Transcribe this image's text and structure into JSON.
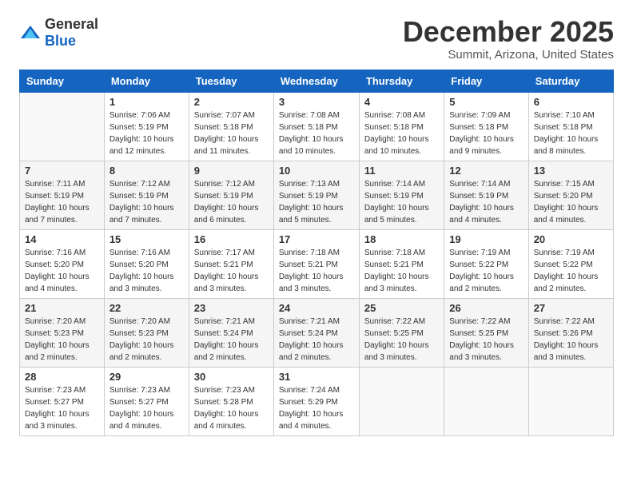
{
  "logo": {
    "general": "General",
    "blue": "Blue"
  },
  "title": "December 2025",
  "subtitle": "Summit, Arizona, United States",
  "weekdays": [
    "Sunday",
    "Monday",
    "Tuesday",
    "Wednesday",
    "Thursday",
    "Friday",
    "Saturday"
  ],
  "weeks": [
    [
      {
        "day": "",
        "info": ""
      },
      {
        "day": "1",
        "info": "Sunrise: 7:06 AM\nSunset: 5:19 PM\nDaylight: 10 hours\nand 12 minutes."
      },
      {
        "day": "2",
        "info": "Sunrise: 7:07 AM\nSunset: 5:18 PM\nDaylight: 10 hours\nand 11 minutes."
      },
      {
        "day": "3",
        "info": "Sunrise: 7:08 AM\nSunset: 5:18 PM\nDaylight: 10 hours\nand 10 minutes."
      },
      {
        "day": "4",
        "info": "Sunrise: 7:08 AM\nSunset: 5:18 PM\nDaylight: 10 hours\nand 10 minutes."
      },
      {
        "day": "5",
        "info": "Sunrise: 7:09 AM\nSunset: 5:18 PM\nDaylight: 10 hours\nand 9 minutes."
      },
      {
        "day": "6",
        "info": "Sunrise: 7:10 AM\nSunset: 5:18 PM\nDaylight: 10 hours\nand 8 minutes."
      }
    ],
    [
      {
        "day": "7",
        "info": "Sunrise: 7:11 AM\nSunset: 5:19 PM\nDaylight: 10 hours\nand 7 minutes."
      },
      {
        "day": "8",
        "info": "Sunrise: 7:12 AM\nSunset: 5:19 PM\nDaylight: 10 hours\nand 7 minutes."
      },
      {
        "day": "9",
        "info": "Sunrise: 7:12 AM\nSunset: 5:19 PM\nDaylight: 10 hours\nand 6 minutes."
      },
      {
        "day": "10",
        "info": "Sunrise: 7:13 AM\nSunset: 5:19 PM\nDaylight: 10 hours\nand 5 minutes."
      },
      {
        "day": "11",
        "info": "Sunrise: 7:14 AM\nSunset: 5:19 PM\nDaylight: 10 hours\nand 5 minutes."
      },
      {
        "day": "12",
        "info": "Sunrise: 7:14 AM\nSunset: 5:19 PM\nDaylight: 10 hours\nand 4 minutes."
      },
      {
        "day": "13",
        "info": "Sunrise: 7:15 AM\nSunset: 5:20 PM\nDaylight: 10 hours\nand 4 minutes."
      }
    ],
    [
      {
        "day": "14",
        "info": "Sunrise: 7:16 AM\nSunset: 5:20 PM\nDaylight: 10 hours\nand 4 minutes."
      },
      {
        "day": "15",
        "info": "Sunrise: 7:16 AM\nSunset: 5:20 PM\nDaylight: 10 hours\nand 3 minutes."
      },
      {
        "day": "16",
        "info": "Sunrise: 7:17 AM\nSunset: 5:21 PM\nDaylight: 10 hours\nand 3 minutes."
      },
      {
        "day": "17",
        "info": "Sunrise: 7:18 AM\nSunset: 5:21 PM\nDaylight: 10 hours\nand 3 minutes."
      },
      {
        "day": "18",
        "info": "Sunrise: 7:18 AM\nSunset: 5:21 PM\nDaylight: 10 hours\nand 3 minutes."
      },
      {
        "day": "19",
        "info": "Sunrise: 7:19 AM\nSunset: 5:22 PM\nDaylight: 10 hours\nand 2 minutes."
      },
      {
        "day": "20",
        "info": "Sunrise: 7:19 AM\nSunset: 5:22 PM\nDaylight: 10 hours\nand 2 minutes."
      }
    ],
    [
      {
        "day": "21",
        "info": "Sunrise: 7:20 AM\nSunset: 5:23 PM\nDaylight: 10 hours\nand 2 minutes."
      },
      {
        "day": "22",
        "info": "Sunrise: 7:20 AM\nSunset: 5:23 PM\nDaylight: 10 hours\nand 2 minutes."
      },
      {
        "day": "23",
        "info": "Sunrise: 7:21 AM\nSunset: 5:24 PM\nDaylight: 10 hours\nand 2 minutes."
      },
      {
        "day": "24",
        "info": "Sunrise: 7:21 AM\nSunset: 5:24 PM\nDaylight: 10 hours\nand 2 minutes."
      },
      {
        "day": "25",
        "info": "Sunrise: 7:22 AM\nSunset: 5:25 PM\nDaylight: 10 hours\nand 3 minutes."
      },
      {
        "day": "26",
        "info": "Sunrise: 7:22 AM\nSunset: 5:25 PM\nDaylight: 10 hours\nand 3 minutes."
      },
      {
        "day": "27",
        "info": "Sunrise: 7:22 AM\nSunset: 5:26 PM\nDaylight: 10 hours\nand 3 minutes."
      }
    ],
    [
      {
        "day": "28",
        "info": "Sunrise: 7:23 AM\nSunset: 5:27 PM\nDaylight: 10 hours\nand 3 minutes."
      },
      {
        "day": "29",
        "info": "Sunrise: 7:23 AM\nSunset: 5:27 PM\nDaylight: 10 hours\nand 4 minutes."
      },
      {
        "day": "30",
        "info": "Sunrise: 7:23 AM\nSunset: 5:28 PM\nDaylight: 10 hours\nand 4 minutes."
      },
      {
        "day": "31",
        "info": "Sunrise: 7:24 AM\nSunset: 5:29 PM\nDaylight: 10 hours\nand 4 minutes."
      },
      {
        "day": "",
        "info": ""
      },
      {
        "day": "",
        "info": ""
      },
      {
        "day": "",
        "info": ""
      }
    ]
  ]
}
